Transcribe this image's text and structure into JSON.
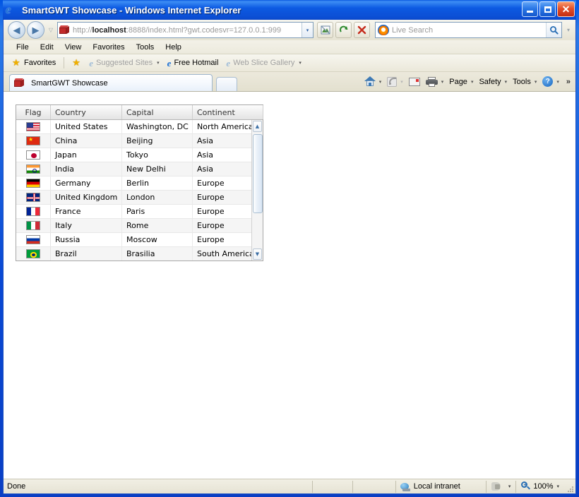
{
  "window": {
    "title": "SmartGWT Showcase - Windows Internet Explorer",
    "app_icon": "ie-logo-icon",
    "minimize_label": "",
    "maximize_label": "",
    "close_label": "✕"
  },
  "navigation": {
    "back_label": "◀",
    "forward_label": "▶",
    "recent_pages_label": "▽",
    "url_prefix": "http://",
    "url_host": "localhost",
    "url_rest": ":8888/index.html?gwt.codesvr=127.0.0.1:999",
    "url_dropdown_label": "▾",
    "compat_view_label": "",
    "refresh_label": "",
    "stop_label": "✕"
  },
  "search": {
    "placeholder": "Live Search",
    "provider_icon": "bing-icon",
    "go_label": "",
    "dropdown_label": "▾"
  },
  "menu": {
    "items": [
      {
        "label": "File"
      },
      {
        "label": "Edit"
      },
      {
        "label": "View"
      },
      {
        "label": "Favorites"
      },
      {
        "label": "Tools"
      },
      {
        "label": "Help"
      }
    ]
  },
  "favorites_bar": {
    "favorites_label": "Favorites",
    "items": [
      {
        "label": "Suggested Sites",
        "dropdown": "▾",
        "dim": true
      },
      {
        "label": "Free Hotmail",
        "dropdown": "",
        "dim": false
      },
      {
        "label": "Web Slice Gallery",
        "dropdown": "▾",
        "dim": true
      }
    ]
  },
  "tabs": {
    "active": {
      "label": "SmartGWT Showcase",
      "icon": "gwt-cube-icon"
    },
    "new_tab_label": ""
  },
  "command_bar": {
    "home_label": "",
    "home_caret": "▾",
    "feeds_label": "",
    "feeds_caret": "▾",
    "mail_label": "",
    "print_label": "",
    "print_caret": "▾",
    "page_label": "Page",
    "page_caret": "▾",
    "safety_label": "Safety",
    "safety_caret": "▾",
    "tools_label": "Tools",
    "tools_caret": "▾",
    "help_label": "?",
    "help_caret": "▾",
    "overflow_label": "»"
  },
  "grid": {
    "columns": [
      {
        "key": "flag",
        "label": "Flag"
      },
      {
        "key": "country",
        "label": "Country"
      },
      {
        "key": "capital",
        "label": "Capital"
      },
      {
        "key": "continent",
        "label": "Continent"
      }
    ],
    "rows": [
      {
        "flag": "flag-us",
        "flag_name": "flag-united-states",
        "country": "United States",
        "capital": "Washington, DC",
        "continent": "North America"
      },
      {
        "flag": "flag-cn",
        "flag_name": "flag-china",
        "country": "China",
        "capital": "Beijing",
        "continent": "Asia"
      },
      {
        "flag": "flag-jp",
        "flag_name": "flag-japan",
        "country": "Japan",
        "capital": "Tokyo",
        "continent": "Asia"
      },
      {
        "flag": "flag-in",
        "flag_name": "flag-india",
        "country": "India",
        "capital": "New Delhi",
        "continent": "Asia"
      },
      {
        "flag": "flag-de",
        "flag_name": "flag-germany",
        "country": "Germany",
        "capital": "Berlin",
        "continent": "Europe"
      },
      {
        "flag": "flag-gb",
        "flag_name": "flag-united-kingdom",
        "country": "United Kingdom",
        "capital": "London",
        "continent": "Europe"
      },
      {
        "flag": "flag-fr",
        "flag_name": "flag-france",
        "country": "France",
        "capital": "Paris",
        "continent": "Europe"
      },
      {
        "flag": "flag-it",
        "flag_name": "flag-italy",
        "country": "Italy",
        "capital": "Rome",
        "continent": "Europe"
      },
      {
        "flag": "flag-ru",
        "flag_name": "flag-russia",
        "country": "Russia",
        "capital": "Moscow",
        "continent": "Europe"
      },
      {
        "flag": "flag-br",
        "flag_name": "flag-brazil",
        "country": "Brazil",
        "capital": "Brasilia",
        "continent": "South America"
      }
    ],
    "scrollbar": {
      "up_label": "▲",
      "down_label": "▼"
    }
  },
  "status_bar": {
    "status_text": "Done",
    "zone_label": "Local intranet",
    "protected_caret": "▾",
    "zoom_label": "100%",
    "zoom_caret": "▾"
  },
  "colors": {
    "title_blue": "#0a3fc4",
    "chrome_beige": "#e8e6d8",
    "grid_border": "#a7a7a7",
    "row_alt": "#f5f5f5",
    "accent": "#2a6fb5"
  }
}
